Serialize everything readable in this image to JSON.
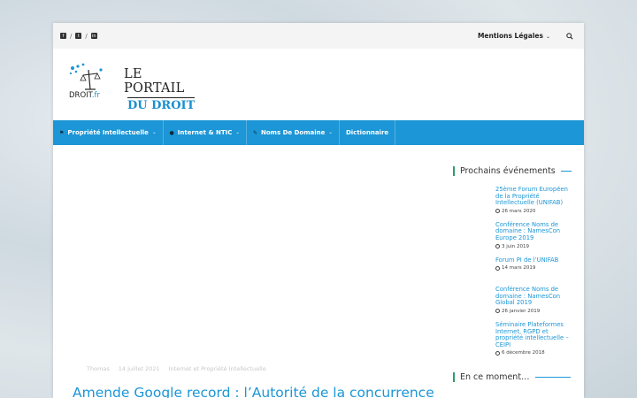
{
  "topbar": {
    "social": [
      {
        "icon": "facebook-icon",
        "glyph": "f"
      },
      {
        "icon": "twitter-icon",
        "glyph": "t"
      },
      {
        "icon": "linkedin-icon",
        "glyph": "in"
      }
    ],
    "separator": "/",
    "mentions_label": "Mentions Légales",
    "mentions_chevron": "⌄"
  },
  "logo": {
    "line1": "LE PORTAIL",
    "line2": "DU DROIT",
    "droit": "DROIT",
    "fr": ".fr"
  },
  "nav": [
    {
      "icon": "flag-icon",
      "glyph": "⚑",
      "label": "Propriété Intellectuelle",
      "chevron": "⌄"
    },
    {
      "icon": "bomb-icon",
      "glyph": "●",
      "label": "Internet & NTIC",
      "chevron": "⌄"
    },
    {
      "icon": "pen-icon",
      "glyph": "✎",
      "label": "Noms De Domaine",
      "chevron": "⌄"
    },
    {
      "icon": "",
      "glyph": "",
      "label": "Dictionnaire",
      "chevron": ""
    }
  ],
  "article": {
    "author": "Thomas",
    "date": "14 juillet 2021",
    "category": "Internet et Propriété Intellectuelle",
    "title": "Amende Google record : l’Autorité de la concurrence"
  },
  "sidebar": {
    "events_title": "Prochains événements",
    "events": [
      {
        "title": "25ème Forum Européen de la Propriété Intellectuelle (UNIFAB)",
        "date": "26 mars 2020"
      },
      {
        "title": "Conférence Noms de domaine : NamesCon Europe 2019",
        "date": "3 juin 2019"
      },
      {
        "title": "Forum PI de l’UNIFAB",
        "date": "14 mars 2019"
      },
      {
        "title": "Conférence Noms de domaine : NamesCon Global 2019",
        "date": "26 janvier 2019"
      },
      {
        "title": "Séminaire Plateformes Internet, RGPD et propriété intellectuelle – CEIPI",
        "date": "6 décembre 2018"
      }
    ],
    "moment_title": "En ce moment…"
  },
  "colors": {
    "accent": "#1c96d6",
    "widget_bar": "#2a9d6a"
  }
}
